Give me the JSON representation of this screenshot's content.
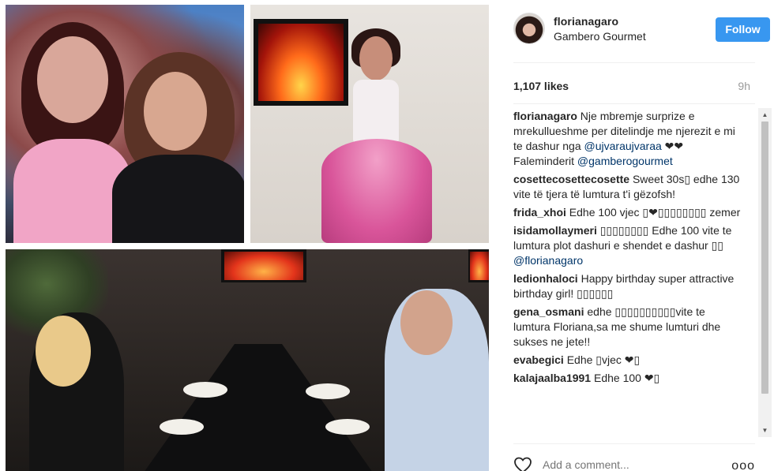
{
  "post": {
    "username": "florianagaro",
    "location": "Gambero Gourmet",
    "follow_label": "Follow",
    "likes": "1,107 likes",
    "time": "9h"
  },
  "comments": [
    {
      "user": "florianagaro",
      "text": " Nje mbremje surprize e mrekullueshme per ditelindje me njerezit e mi te dashur nga ",
      "mention1": "@ujvaraujvaraa",
      "text2": " ❤❤ Faleminderit ",
      "mention2": "@gamberogourmet"
    },
    {
      "user": "cosettecosettecosette",
      "text": " Sweet 30s▯ edhe 130 vite të tjera të lumtura t'i gëzofsh!"
    },
    {
      "user": "frida_xhoi",
      "text": " Edhe 100 vjec ▯❤▯▯▯▯▯▯▯▯ zemer"
    },
    {
      "user": "isidamollaymeri",
      "text": " ▯▯▯▯▯▯▯▯ Edhe 100 vite te lumtura plot dashuri e shendet e dashur ▯▯ ",
      "mention1": "@florianagaro"
    },
    {
      "user": "ledionhaloci",
      "text": " Happy birthday super attractive birthday girl! ▯▯▯▯▯▯"
    },
    {
      "user": "gena_osmani",
      "text": " edhe ▯▯▯▯▯▯▯▯▯▯vite te lumtura Floriana,sa me shume lumturi dhe sukses ne jete!!"
    },
    {
      "user": "evabegici",
      "text": " Edhe ▯vjec ❤▯"
    },
    {
      "user": "kalajaalba1991",
      "text": " Edhe 100 ❤▯"
    }
  ],
  "add_comment_placeholder": "Add a comment...",
  "more_label": "ooo",
  "icons": {
    "heart": "heart-icon",
    "more": "more-options-icon",
    "scroll_up": "scroll-up-arrow-icon",
    "scroll_down": "scroll-down-arrow-icon"
  },
  "colors": {
    "follow_button": "#3897f0",
    "mention": "#003569",
    "secondary_text": "#999999"
  }
}
